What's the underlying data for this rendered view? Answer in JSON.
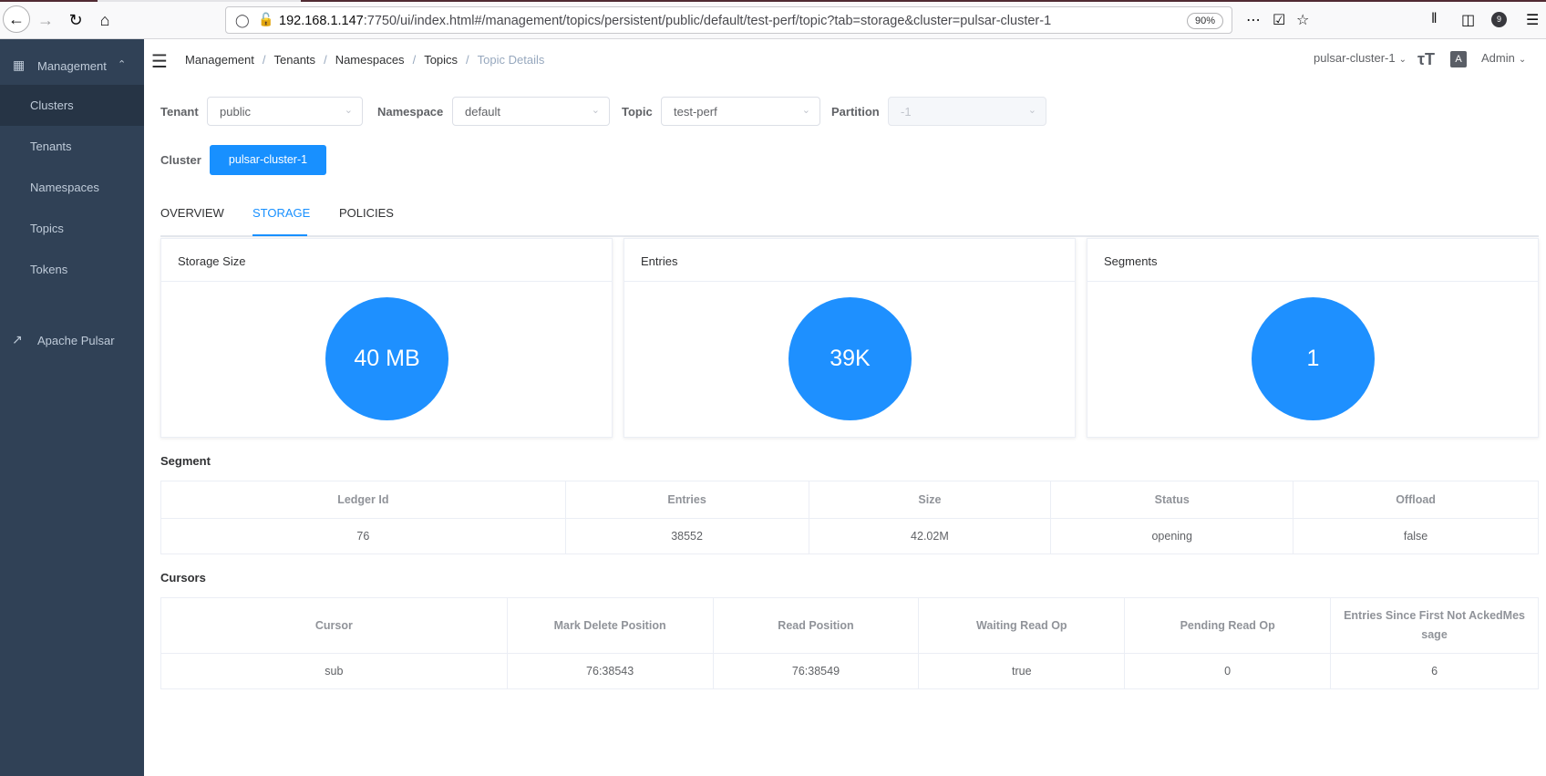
{
  "browser": {
    "url_host": "192.168.1.147",
    "url_rest": ":7750/ui/index.html#/management/topics/persistent/public/default/test-perf/topic?tab=storage&cluster=pulsar-cluster-1",
    "zoom": "90%",
    "badge_count": "9"
  },
  "sidebar": {
    "section_label": "Management",
    "items": [
      {
        "label": "Clusters"
      },
      {
        "label": "Tenants"
      },
      {
        "label": "Namespaces"
      },
      {
        "label": "Topics"
      },
      {
        "label": "Tokens"
      }
    ],
    "external_label": "Apache Pulsar"
  },
  "navbar": {
    "breadcrumb": [
      "Management",
      "Tenants",
      "Namespaces",
      "Topics",
      "Topic Details"
    ],
    "cluster_select": "pulsar-cluster-1",
    "lang_icon_text": "A",
    "user": "Admin"
  },
  "filters": {
    "tenant_label": "Tenant",
    "tenant_value": "public",
    "namespace_label": "Namespace",
    "namespace_value": "default",
    "topic_label": "Topic",
    "topic_value": "test-perf",
    "partition_label": "Partition",
    "partition_value": "-1",
    "cluster_label": "Cluster",
    "cluster_button": "pulsar-cluster-1"
  },
  "tabs": [
    {
      "label": "OVERVIEW",
      "active": false
    },
    {
      "label": "STORAGE",
      "active": true
    },
    {
      "label": "POLICIES",
      "active": false
    }
  ],
  "cards": [
    {
      "title": "Storage Size",
      "value": "40 MB"
    },
    {
      "title": "Entries",
      "value": "39K"
    },
    {
      "title": "Segments",
      "value": "1"
    }
  ],
  "segment": {
    "title": "Segment",
    "headers": [
      "Ledger Id",
      "Entries",
      "Size",
      "Status",
      "Offload"
    ],
    "rows": [
      [
        "76",
        "38552",
        "42.02M",
        "opening",
        "false"
      ]
    ]
  },
  "cursors": {
    "title": "Cursors",
    "headers": [
      "Cursor",
      "Mark Delete Position",
      "Read Position",
      "Waiting Read Op",
      "Pending Read Op",
      "Entries Since First Not AckedMes sage"
    ],
    "rows": [
      [
        "sub",
        "76:38543",
        "76:38549",
        "true",
        "0",
        "6"
      ]
    ]
  },
  "colors": {
    "sidebar_bg": "#304156",
    "sidebar_active_bg": "#263445",
    "accent": "#1890ff",
    "circle": "#1e90ff"
  }
}
